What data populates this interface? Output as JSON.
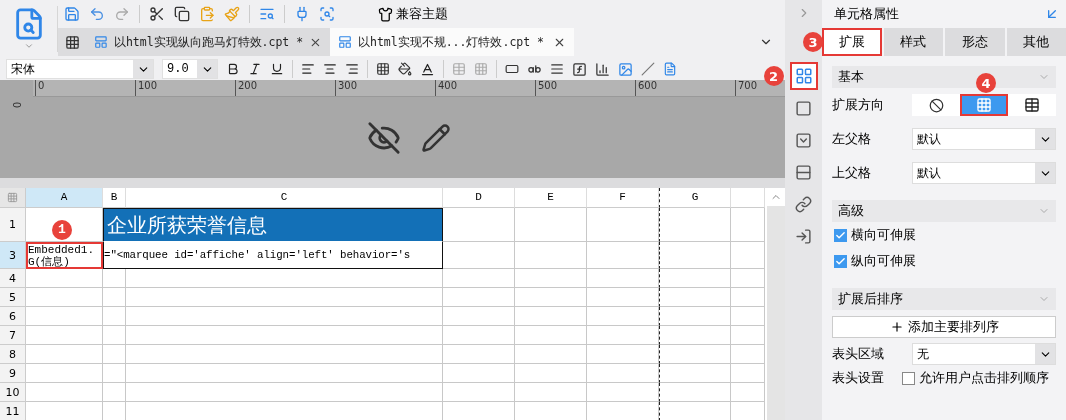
{
  "toolbar": {
    "theme_button": "兼容主题"
  },
  "file_tabs": [
    {
      "label": "以html实现纵向跑马灯特效.cpt *",
      "selected": false
    },
    {
      "label": "以html实现不规...灯特效.cpt *",
      "selected": true
    }
  ],
  "format_bar": {
    "font": "宋体",
    "size": "9.0"
  },
  "ruler": {
    "labels": [
      "0",
      "100",
      "200",
      "300",
      "400",
      "500",
      "600",
      "700"
    ],
    "side_label": "0"
  },
  "grid": {
    "columns": [
      {
        "label": "A",
        "selected": true,
        "page_break": false
      },
      {
        "label": "B",
        "selected": false,
        "page_break": false
      },
      {
        "label": "C",
        "selected": false,
        "page_break": false
      },
      {
        "label": "D",
        "selected": false,
        "page_break": false
      },
      {
        "label": "E",
        "selected": false,
        "page_break": false
      },
      {
        "label": "F",
        "selected": false,
        "page_break": false
      },
      {
        "label": "G",
        "selected": false,
        "page_break": true
      }
    ],
    "rows": [
      {
        "label": "1",
        "selected": false,
        "kind": "title",
        "cells": [
          {
            "text": "企业所获荣誉信息"
          }
        ]
      },
      {
        "label": "3",
        "selected": true,
        "kind": "data",
        "cells": [
          {
            "text": "Embedded1.G(信息)",
            "selected": true,
            "badge": "1"
          },
          {
            "text": "=\"<marquee id='affiche' align='left' behavior='s",
            "selected": false
          }
        ]
      },
      {
        "label": "4",
        "selected": false
      },
      {
        "label": "5",
        "selected": false
      },
      {
        "label": "6",
        "selected": false
      },
      {
        "label": "7",
        "selected": false
      },
      {
        "label": "8",
        "selected": false
      },
      {
        "label": "9",
        "selected": false
      },
      {
        "label": "10",
        "selected": false
      },
      {
        "label": "11",
        "selected": false
      }
    ]
  },
  "side_icons": [
    {
      "kind": "cell",
      "selected": true,
      "highlighted": true,
      "badge": "2"
    },
    {
      "kind": "square",
      "selected": false,
      "highlighted": false
    },
    {
      "kind": "widget",
      "selected": false,
      "highlighted": false
    },
    {
      "kind": "condition",
      "selected": false,
      "highlighted": false
    },
    {
      "kind": "link",
      "selected": false,
      "highlighted": false
    },
    {
      "kind": "import",
      "selected": false,
      "highlighted": false
    }
  ],
  "panel": {
    "title": "单元格属性",
    "tabs": [
      {
        "label": "扩展",
        "selected": true,
        "highlighted": true,
        "badge": "3"
      },
      {
        "label": "样式",
        "selected": false,
        "highlighted": false
      },
      {
        "label": "形态",
        "selected": false,
        "highlighted": false
      },
      {
        "label": "其他",
        "selected": false,
        "highlighted": false
      }
    ],
    "basic": {
      "header": "基本",
      "direction_label": "扩展方向",
      "directions": [
        {
          "kind": "none",
          "selected": false,
          "highlighted": false
        },
        {
          "kind": "vertical",
          "selected": true,
          "highlighted": true,
          "badge": "4"
        },
        {
          "kind": "horizontal",
          "selected": false,
          "highlighted": false
        }
      ],
      "left_parent_label": "左父格",
      "left_parent": "默认",
      "top_parent_label": "上父格",
      "top_parent": "默认"
    },
    "advanced": {
      "header": "高级",
      "options": [
        {
          "label": "横向可伸展",
          "checked": true
        },
        {
          "label": "纵向可伸展",
          "checked": true
        }
      ]
    },
    "sorting": {
      "header": "扩展后排序",
      "add_button": "添加主要排列序",
      "header_area_label": "表头区域",
      "header_area": "无",
      "header_setting_label": "表头设置",
      "header_setting_option": {
        "label": "允许用户点击排列顺序",
        "checked": false
      }
    }
  }
}
